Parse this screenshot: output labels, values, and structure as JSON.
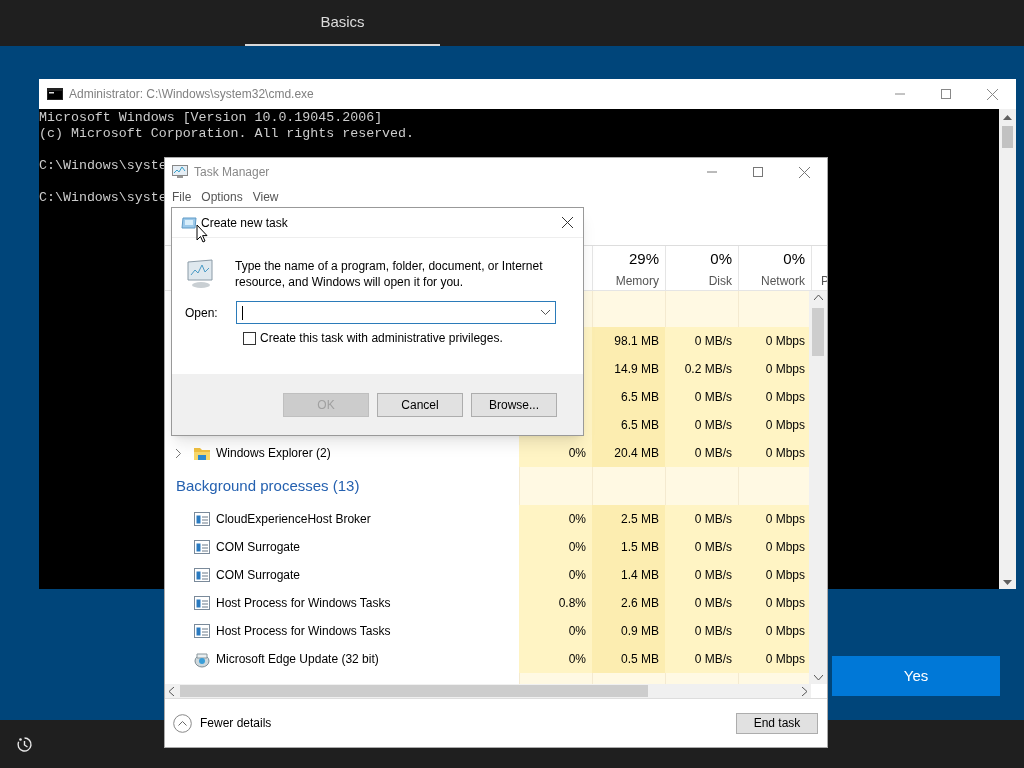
{
  "setup": {
    "tabs": [
      {
        "label": "Basics",
        "selected": true
      }
    ],
    "yes_button": "Yes"
  },
  "console": {
    "title": "Administrator: C:\\Windows\\system32\\cmd.exe",
    "blocks": [
      [
        "Microsoft Windows [Version 10.0.19045.2006]",
        "(c) Microsoft Corporation. All rights reserved."
      ],
      [
        "C:\\Windows\\syste"
      ],
      [
        "C:\\Windows\\syste"
      ]
    ]
  },
  "task_manager": {
    "title": "Task Manager",
    "menu": [
      "File",
      "Options",
      "View"
    ],
    "columns": [
      {
        "percent": "29%",
        "label": "Memory"
      },
      {
        "percent": "0%",
        "label": "Disk"
      },
      {
        "percent": "0%",
        "label": "Network"
      },
      {
        "label": "P"
      }
    ],
    "rows": [
      {
        "kind": "partial",
        "memory": "98.1 MB",
        "disk": "0 MB/s",
        "network": "0 Mbps"
      },
      {
        "kind": "partial",
        "memory": "14.9 MB",
        "disk": "0.2 MB/s",
        "network": "0 Mbps"
      },
      {
        "kind": "partial",
        "memory": "6.5 MB",
        "disk": "0 MB/s",
        "network": "0 Mbps"
      },
      {
        "kind": "partial",
        "memory": "6.5 MB",
        "disk": "0 MB/s",
        "network": "0 Mbps"
      },
      {
        "kind": "app",
        "name": "Windows Explorer (2)",
        "expanded": false,
        "cpu": "0%",
        "memory": "20.4 MB",
        "disk": "0 MB/s",
        "network": "0 Mbps"
      },
      {
        "kind": "group",
        "name": "Background processes (13)"
      },
      {
        "kind": "process",
        "name": "CloudExperienceHost Broker",
        "cpu": "0%",
        "memory": "2.5 MB",
        "disk": "0 MB/s",
        "network": "0 Mbps"
      },
      {
        "kind": "process",
        "name": "COM Surrogate",
        "cpu": "0%",
        "memory": "1.5 MB",
        "disk": "0 MB/s",
        "network": "0 Mbps"
      },
      {
        "kind": "process",
        "name": "COM Surrogate",
        "cpu": "0%",
        "memory": "1.4 MB",
        "disk": "0 MB/s",
        "network": "0 Mbps"
      },
      {
        "kind": "process",
        "name": "Host Process for Windows Tasks",
        "cpu": "0.8%",
        "memory": "2.6 MB",
        "disk": "0 MB/s",
        "network": "0 Mbps"
      },
      {
        "kind": "process",
        "name": "Host Process for Windows Tasks",
        "cpu": "0%",
        "memory": "0.9 MB",
        "disk": "0 MB/s",
        "network": "0 Mbps"
      },
      {
        "kind": "updater",
        "name": "Microsoft Edge Update (32 bit)",
        "cpu": "0%",
        "memory": "0.5 MB",
        "disk": "0 MB/s",
        "network": "0 Mbps"
      }
    ],
    "fewer_details": "Fewer details",
    "end_task": "End task"
  },
  "dialog": {
    "title": "Create new task",
    "message": "Type the name of a program, folder, document, or Internet resource, and Windows will open it for you.",
    "open_label": "Open:",
    "checkbox": {
      "label": "Create this task with administrative privileges.",
      "checked": false
    },
    "buttons": [
      {
        "label": "OK",
        "disabled": true
      },
      {
        "label": "Cancel",
        "disabled": false
      },
      {
        "label": "Browse...",
        "disabled": false
      }
    ]
  }
}
